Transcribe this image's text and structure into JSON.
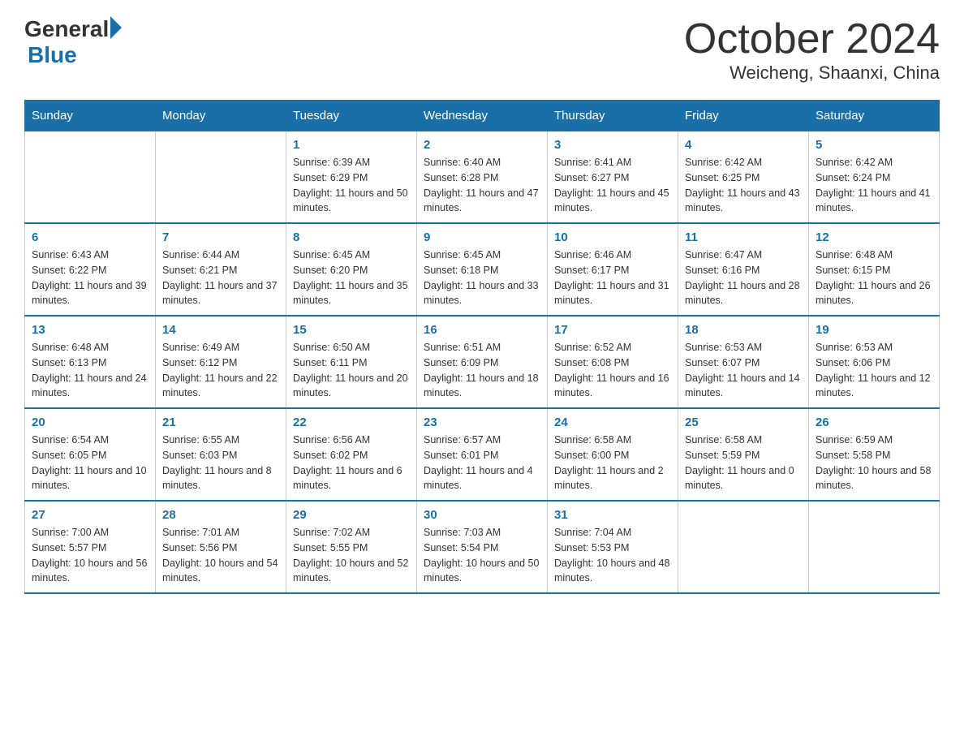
{
  "header": {
    "logo_general": "General",
    "logo_blue": "Blue",
    "month_title": "October 2024",
    "location": "Weicheng, Shaanxi, China"
  },
  "calendar": {
    "days_of_week": [
      "Sunday",
      "Monday",
      "Tuesday",
      "Wednesday",
      "Thursday",
      "Friday",
      "Saturday"
    ],
    "weeks": [
      [
        null,
        null,
        {
          "day": "1",
          "sunrise": "Sunrise: 6:39 AM",
          "sunset": "Sunset: 6:29 PM",
          "daylight": "Daylight: 11 hours and 50 minutes."
        },
        {
          "day": "2",
          "sunrise": "Sunrise: 6:40 AM",
          "sunset": "Sunset: 6:28 PM",
          "daylight": "Daylight: 11 hours and 47 minutes."
        },
        {
          "day": "3",
          "sunrise": "Sunrise: 6:41 AM",
          "sunset": "Sunset: 6:27 PM",
          "daylight": "Daylight: 11 hours and 45 minutes."
        },
        {
          "day": "4",
          "sunrise": "Sunrise: 6:42 AM",
          "sunset": "Sunset: 6:25 PM",
          "daylight": "Daylight: 11 hours and 43 minutes."
        },
        {
          "day": "5",
          "sunrise": "Sunrise: 6:42 AM",
          "sunset": "Sunset: 6:24 PM",
          "daylight": "Daylight: 11 hours and 41 minutes."
        }
      ],
      [
        {
          "day": "6",
          "sunrise": "Sunrise: 6:43 AM",
          "sunset": "Sunset: 6:22 PM",
          "daylight": "Daylight: 11 hours and 39 minutes."
        },
        {
          "day": "7",
          "sunrise": "Sunrise: 6:44 AM",
          "sunset": "Sunset: 6:21 PM",
          "daylight": "Daylight: 11 hours and 37 minutes."
        },
        {
          "day": "8",
          "sunrise": "Sunrise: 6:45 AM",
          "sunset": "Sunset: 6:20 PM",
          "daylight": "Daylight: 11 hours and 35 minutes."
        },
        {
          "day": "9",
          "sunrise": "Sunrise: 6:45 AM",
          "sunset": "Sunset: 6:18 PM",
          "daylight": "Daylight: 11 hours and 33 minutes."
        },
        {
          "day": "10",
          "sunrise": "Sunrise: 6:46 AM",
          "sunset": "Sunset: 6:17 PM",
          "daylight": "Daylight: 11 hours and 31 minutes."
        },
        {
          "day": "11",
          "sunrise": "Sunrise: 6:47 AM",
          "sunset": "Sunset: 6:16 PM",
          "daylight": "Daylight: 11 hours and 28 minutes."
        },
        {
          "day": "12",
          "sunrise": "Sunrise: 6:48 AM",
          "sunset": "Sunset: 6:15 PM",
          "daylight": "Daylight: 11 hours and 26 minutes."
        }
      ],
      [
        {
          "day": "13",
          "sunrise": "Sunrise: 6:48 AM",
          "sunset": "Sunset: 6:13 PM",
          "daylight": "Daylight: 11 hours and 24 minutes."
        },
        {
          "day": "14",
          "sunrise": "Sunrise: 6:49 AM",
          "sunset": "Sunset: 6:12 PM",
          "daylight": "Daylight: 11 hours and 22 minutes."
        },
        {
          "day": "15",
          "sunrise": "Sunrise: 6:50 AM",
          "sunset": "Sunset: 6:11 PM",
          "daylight": "Daylight: 11 hours and 20 minutes."
        },
        {
          "day": "16",
          "sunrise": "Sunrise: 6:51 AM",
          "sunset": "Sunset: 6:09 PM",
          "daylight": "Daylight: 11 hours and 18 minutes."
        },
        {
          "day": "17",
          "sunrise": "Sunrise: 6:52 AM",
          "sunset": "Sunset: 6:08 PM",
          "daylight": "Daylight: 11 hours and 16 minutes."
        },
        {
          "day": "18",
          "sunrise": "Sunrise: 6:53 AM",
          "sunset": "Sunset: 6:07 PM",
          "daylight": "Daylight: 11 hours and 14 minutes."
        },
        {
          "day": "19",
          "sunrise": "Sunrise: 6:53 AM",
          "sunset": "Sunset: 6:06 PM",
          "daylight": "Daylight: 11 hours and 12 minutes."
        }
      ],
      [
        {
          "day": "20",
          "sunrise": "Sunrise: 6:54 AM",
          "sunset": "Sunset: 6:05 PM",
          "daylight": "Daylight: 11 hours and 10 minutes."
        },
        {
          "day": "21",
          "sunrise": "Sunrise: 6:55 AM",
          "sunset": "Sunset: 6:03 PM",
          "daylight": "Daylight: 11 hours and 8 minutes."
        },
        {
          "day": "22",
          "sunrise": "Sunrise: 6:56 AM",
          "sunset": "Sunset: 6:02 PM",
          "daylight": "Daylight: 11 hours and 6 minutes."
        },
        {
          "day": "23",
          "sunrise": "Sunrise: 6:57 AM",
          "sunset": "Sunset: 6:01 PM",
          "daylight": "Daylight: 11 hours and 4 minutes."
        },
        {
          "day": "24",
          "sunrise": "Sunrise: 6:58 AM",
          "sunset": "Sunset: 6:00 PM",
          "daylight": "Daylight: 11 hours and 2 minutes."
        },
        {
          "day": "25",
          "sunrise": "Sunrise: 6:58 AM",
          "sunset": "Sunset: 5:59 PM",
          "daylight": "Daylight: 11 hours and 0 minutes."
        },
        {
          "day": "26",
          "sunrise": "Sunrise: 6:59 AM",
          "sunset": "Sunset: 5:58 PM",
          "daylight": "Daylight: 10 hours and 58 minutes."
        }
      ],
      [
        {
          "day": "27",
          "sunrise": "Sunrise: 7:00 AM",
          "sunset": "Sunset: 5:57 PM",
          "daylight": "Daylight: 10 hours and 56 minutes."
        },
        {
          "day": "28",
          "sunrise": "Sunrise: 7:01 AM",
          "sunset": "Sunset: 5:56 PM",
          "daylight": "Daylight: 10 hours and 54 minutes."
        },
        {
          "day": "29",
          "sunrise": "Sunrise: 7:02 AM",
          "sunset": "Sunset: 5:55 PM",
          "daylight": "Daylight: 10 hours and 52 minutes."
        },
        {
          "day": "30",
          "sunrise": "Sunrise: 7:03 AM",
          "sunset": "Sunset: 5:54 PM",
          "daylight": "Daylight: 10 hours and 50 minutes."
        },
        {
          "day": "31",
          "sunrise": "Sunrise: 7:04 AM",
          "sunset": "Sunset: 5:53 PM",
          "daylight": "Daylight: 10 hours and 48 minutes."
        },
        null,
        null
      ]
    ]
  }
}
